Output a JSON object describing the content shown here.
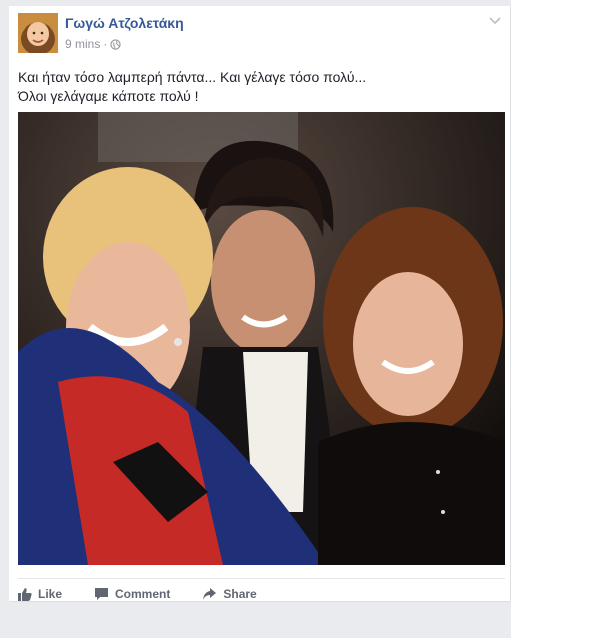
{
  "post": {
    "author": "Γωγώ Ατζολετάκη",
    "time": "9 mins",
    "separator": "·",
    "privacy_icon": "globe-icon",
    "text_line1": "Και ήταν τόσο λαμπερή πάντα... Και γέλαγε τόσο πολύ...",
    "text_line2": "Όλοι γελάγαμε κάποτε πολύ !"
  },
  "actions": {
    "like": "Like",
    "comment": "Comment",
    "share": "Share"
  },
  "colors": {
    "author": "#365899",
    "meta": "#90949c",
    "text": "#1d2129",
    "action": "#606770",
    "background": "#e9ebee"
  }
}
